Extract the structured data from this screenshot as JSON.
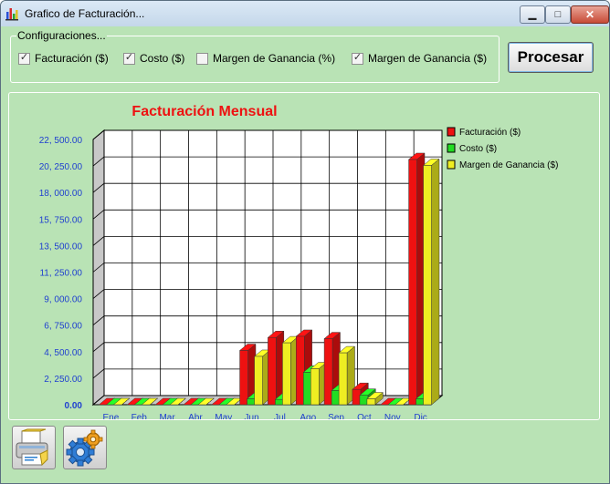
{
  "window": {
    "title": "Grafico de Facturación..."
  },
  "titlebar_buttons": {
    "minimize_glyph": "▁",
    "maximize_glyph": "□",
    "close_glyph": "✕"
  },
  "config": {
    "legend": "Configuraciones...",
    "options": [
      {
        "label": "Facturación ($)",
        "checked": true
      },
      {
        "label": "Costo ($)",
        "checked": true
      },
      {
        "label": "Margen de Ganancia (%)",
        "checked": false
      },
      {
        "label": "Margen de Ganancia ($)",
        "checked": true
      }
    ],
    "check_glyph": "✓"
  },
  "actions": {
    "process_label": "Procesar"
  },
  "toolbar": {
    "print_icon": "printer-icon",
    "settings_icon": "gear-icon"
  },
  "colors": {
    "window_bg": "#b9e3b5",
    "title_red": "#ee1111",
    "axis_blue": "#1f3fd0",
    "facturacion": "#ee1111",
    "costo": "#22dd22",
    "margen": "#eeee22"
  },
  "chart_data": {
    "type": "bar",
    "title": "Facturación Mensual",
    "xlabel": "",
    "ylabel": "",
    "categories": [
      "Ene",
      "Feb",
      "Mar",
      "Abr",
      "May",
      "Jun",
      "Jul",
      "Ago",
      "Sep",
      "Oct",
      "Nov",
      "Dic"
    ],
    "yticks": [
      "0.00",
      "2, 250.00",
      "4, 500.00",
      "6, 750.00",
      "9, 000.00",
      "11, 250.00",
      "13, 500.00",
      "15, 750.00",
      "18, 000.00",
      "20, 250.00",
      "22, 500.00"
    ],
    "ylim": [
      0,
      22500
    ],
    "three_d": true,
    "grid": true,
    "legend_position": "right",
    "series": [
      {
        "name": "Facturación ($)",
        "color": "#ee1111",
        "values": [
          0,
          0,
          0,
          0,
          0,
          4600,
          5700,
          5800,
          5600,
          1300,
          0,
          20800
        ]
      },
      {
        "name": "Costo ($)",
        "color": "#22dd22",
        "values": [
          0,
          0,
          0,
          0,
          0,
          500,
          450,
          2750,
          1200,
          800,
          0,
          500
        ]
      },
      {
        "name": "Margen de Ganancia ($)",
        "color": "#eeee22",
        "values": [
          0,
          0,
          0,
          0,
          0,
          4100,
          5250,
          3050,
          4400,
          500,
          0,
          20300
        ]
      }
    ]
  }
}
